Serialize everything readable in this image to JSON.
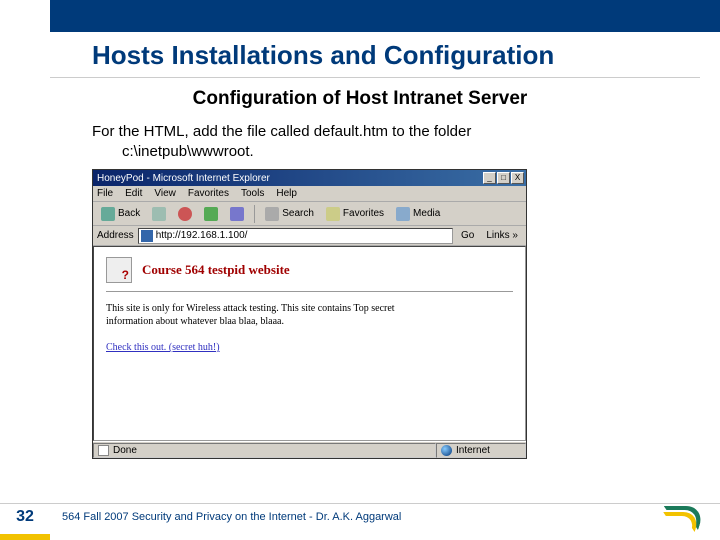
{
  "slide": {
    "title": "Hosts Installations and Configuration",
    "subtitle": "Configuration of Host Intranet Server",
    "body_line1": "For the HTML, add the file called default.htm to the folder",
    "body_line2": "c:\\inetpub\\wwwroot.",
    "page_number": "32",
    "footer": "564  Fall 2007 Security and Privacy on the Internet - Dr. A.K. Aggarwal"
  },
  "ie": {
    "title": "HoneyPod - Microsoft Internet Explorer",
    "btn_min": "_",
    "btn_max": "□",
    "btn_close": "X",
    "menu": {
      "file": "File",
      "edit": "Edit",
      "view": "View",
      "favorites": "Favorites",
      "tools": "Tools",
      "help": "Help"
    },
    "toolbar": {
      "back": "Back",
      "search": "Search",
      "favorites": "Favorites",
      "media": "Media"
    },
    "address_label": "Address",
    "url": "http://192.168.1.100/",
    "go": "Go",
    "links": "Links »",
    "status_done": "Done",
    "status_zone": "Internet"
  },
  "page": {
    "heading": "Course 564 testpid website",
    "paragraph": "This site is only for Wireless attack testing. This site contains Top secret information about whatever blaa blaa, blaaa.",
    "link": "Check this out. (secret huh!)"
  }
}
